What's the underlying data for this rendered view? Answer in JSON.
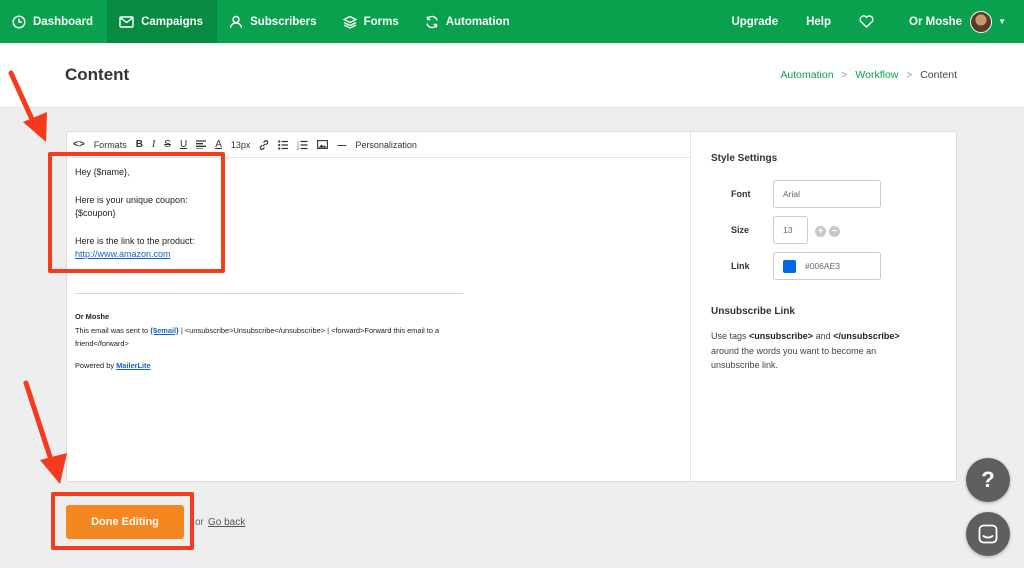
{
  "nav": {
    "items": [
      {
        "label": "Dashboard",
        "icon": "dashboard-icon"
      },
      {
        "label": "Campaigns",
        "icon": "envelope-icon",
        "active": true
      },
      {
        "label": "Subscribers",
        "icon": "user-icon"
      },
      {
        "label": "Forms",
        "icon": "layers-icon"
      },
      {
        "label": "Automation",
        "icon": "refresh-icon"
      }
    ],
    "upgrade": "Upgrade",
    "help": "Help",
    "favorite_icon": "heart-icon",
    "user_name": "Or Moshe",
    "brand_color": "#09a14d"
  },
  "header": {
    "title": "Content",
    "breadcrumb": {
      "automation": "Automation",
      "workflow": "Workflow",
      "current": "Content"
    }
  },
  "toolbar": {
    "formats": "Formats",
    "font_size": "13px",
    "personalization": "Personalization"
  },
  "email": {
    "greeting": "Hey {$name},",
    "coupon_line": "Here is your unique coupon:",
    "coupon_tag": "{$coupon}",
    "link_line": "Here is the link to the product:",
    "link_url": "http://www.amazon.com"
  },
  "footer": {
    "sender": "Or Moshe",
    "sent_to_prefix": "This email was sent to ",
    "email_tag": "{$email}",
    "unsub_text": " | <unsubscribe>Unsubscribe</unsubscribe> | <forward>Forward this email to a friend</forward>",
    "powered_by": "Powered by ",
    "brand": "MailerLite"
  },
  "settings": {
    "title": "Style Settings",
    "font_label": "Font",
    "font_value": "Arial",
    "size_label": "Size",
    "size_value": "13",
    "link_label": "Link",
    "link_color": "#006AE3",
    "unsub_title": "Unsubscribe Link",
    "unsub_pre": "Use tags ",
    "unsub_tag_open": "<unsubscribe>",
    "unsub_and": " and ",
    "unsub_tag_close": "</unsubscribe>",
    "unsub_post": " around the words you want to become an unsubscribe link."
  },
  "actions": {
    "done": "Done Editing",
    "or": "or",
    "go_back": "Go back"
  },
  "help_button": "?",
  "colors": {
    "done_button": "#f4871f",
    "annotation": "#f53a1e",
    "link_color": "#006ae3"
  }
}
